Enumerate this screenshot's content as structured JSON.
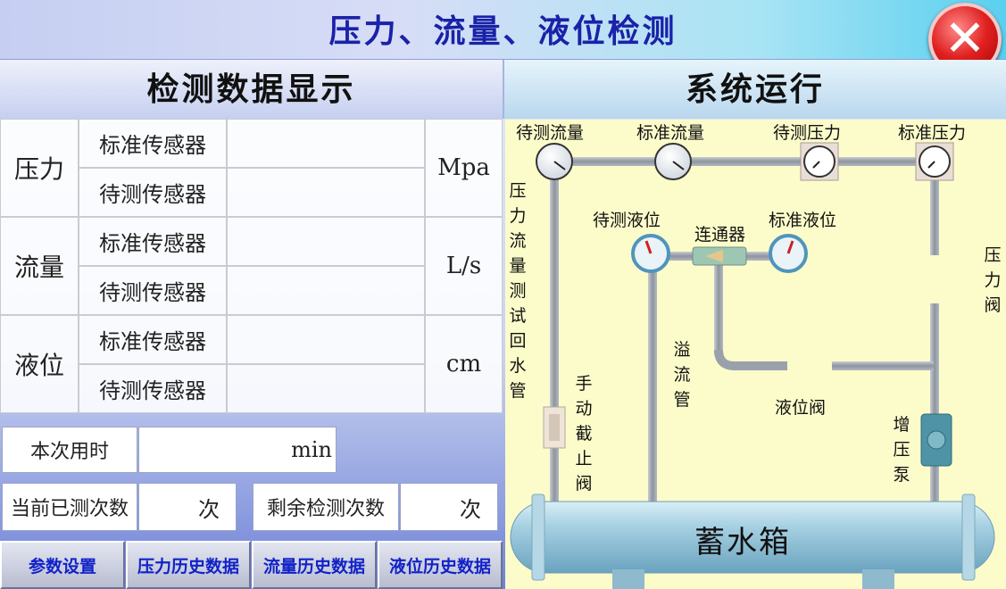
{
  "window": {
    "title": "压力、流量、液位检测",
    "close_icon": "close-icon"
  },
  "left_panel": {
    "title": "检测数据显示",
    "rows": [
      {
        "label": "压力",
        "unit": "Mpa",
        "sensors": [
          "标准传感器",
          "待测传感器"
        ]
      },
      {
        "label": "流量",
        "unit": "L/s",
        "sensors": [
          "标准传感器",
          "待测传感器"
        ]
      },
      {
        "label": "液位",
        "unit": "cm",
        "sensors": [
          "标准传感器",
          "待测传感器"
        ]
      }
    ],
    "time_used_label": "本次用时",
    "time_used_unit": "min",
    "tested_count_label": "当前已测次数",
    "tested_count_unit": "次",
    "remaining_count_label": "剩余检测次数",
    "remaining_count_unit": "次"
  },
  "buttons": {
    "params": "参数设置",
    "pressure_history": "压力历史数据",
    "flow_history": "流量历史数据",
    "level_history": "液位历史数据"
  },
  "right_panel": {
    "title": "系统运行",
    "labels": {
      "flow_test": "待测流量",
      "flow_std": "标准流量",
      "pressure_test": "待测压力",
      "pressure_std": "标准压力",
      "level_test": "待测液位",
      "connector": "连通器",
      "level_std": "标准液位",
      "return_pipe": "压力流量测试回水管",
      "pressure_valve": "压力阀",
      "overflow_pipe": "溢流管",
      "level_valve": "液位阀",
      "manual_valve": "手动截止阀",
      "booster_pump": "增压泵",
      "tank": "蓄水箱"
    },
    "colors": {
      "pipe": "#9aa1ab",
      "diagram_bg": "#fcfccb",
      "title_blue": "#1a22a8"
    }
  }
}
